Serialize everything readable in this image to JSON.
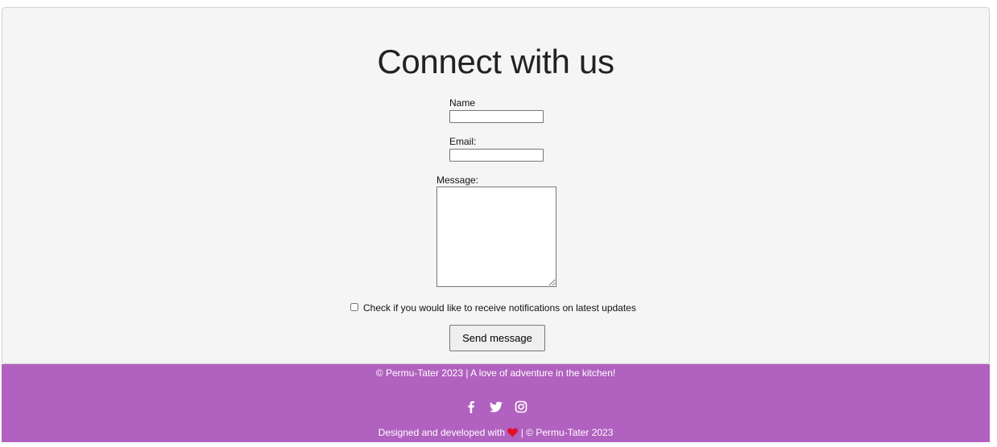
{
  "contact": {
    "heading": "Connect with us",
    "name_label": "Name",
    "email_label": "Email:",
    "message_label": "Message:",
    "name_value": "",
    "email_value": "",
    "message_value": "",
    "checkbox_label": "Check if you would like to receive notifications on latest updates",
    "checkbox_checked": false,
    "send_label": "Send message"
  },
  "footer": {
    "tagline": "© Permu-Tater 2023 | A love of adventure in the kitchen!",
    "credit_prefix": "Designed and developed with",
    "credit_suffix": "| © Permu-Tater 2023",
    "socials": [
      "facebook-icon",
      "twitter-icon",
      "instagram-icon"
    ]
  },
  "colors": {
    "footer_bg": "#b161bf",
    "panel_bg": "#f5f5f5",
    "heart": "#e0102a"
  }
}
